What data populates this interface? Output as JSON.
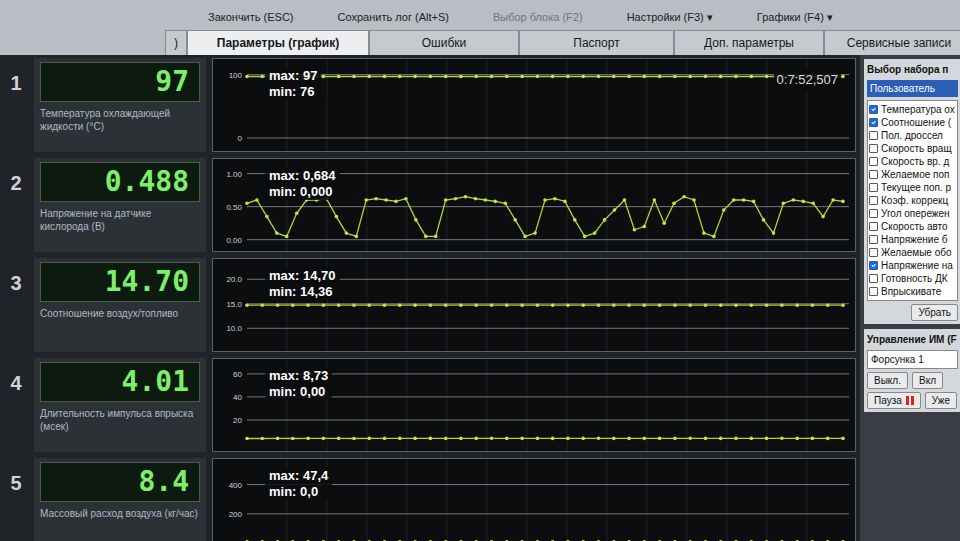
{
  "menu": [
    {
      "label": "Закончить (ESC)",
      "disabled": false
    },
    {
      "label": "Сохранить лог (Alt+S)",
      "disabled": false
    },
    {
      "label": "Выбор блока (F2)",
      "disabled": true
    },
    {
      "label": "Настройки (F3) ▾",
      "disabled": false
    },
    {
      "label": "Графики (F4) ▾",
      "disabled": false
    }
  ],
  "tabs": [
    {
      "label": ")",
      "selected": false
    },
    {
      "label": "Параметры (график)",
      "selected": true
    },
    {
      "label": "Ошибки",
      "selected": false
    },
    {
      "label": "Паспорт",
      "selected": false
    },
    {
      "label": "Доп. параметры",
      "selected": false
    },
    {
      "label": "Сервисные записи",
      "selected": false
    }
  ],
  "params": [
    {
      "number": "1",
      "value": "97",
      "label": "Температура охлаждающей жидкости (°C)",
      "chart": {
        "max": "max: 97",
        "min": "min: 76",
        "time": "0:7:52,507",
        "axis_min": -8,
        "axis_max": 112,
        "ticks": [
          {
            "label": "100",
            "value": 100
          },
          {
            "label": "0",
            "value": 0
          }
        ],
        "values": [
          97,
          97,
          97,
          97,
          97,
          97,
          97,
          97,
          97,
          97,
          97,
          97,
          97,
          97,
          97,
          97,
          97,
          97,
          97,
          97,
          97,
          97,
          97,
          97,
          97,
          97,
          97,
          97,
          97,
          97,
          97,
          97,
          97,
          97,
          97,
          97,
          97,
          97,
          97,
          97
        ]
      }
    },
    {
      "number": "2",
      "value": "0.488",
      "label": "Напряжение на датчике кислорода (В)",
      "chart": {
        "max": "max: 0,684",
        "min": "min: 0,000",
        "axis_min": -0.05,
        "axis_max": 1.1,
        "ticks": [
          {
            "label": "1.00",
            "value": 1.0
          },
          {
            "label": "0.50",
            "value": 0.5
          },
          {
            "label": "0.00",
            "value": 0.0
          }
        ],
        "values": [
          0.55,
          0.6,
          0.35,
          0.1,
          0.05,
          0.4,
          0.6,
          0.6,
          0.62,
          0.35,
          0.1,
          0.05,
          0.6,
          0.62,
          0.6,
          0.58,
          0.62,
          0.3,
          0.05,
          0.05,
          0.6,
          0.62,
          0.65,
          0.62,
          0.6,
          0.58,
          0.55,
          0.3,
          0.05,
          0.1,
          0.6,
          0.62,
          0.58,
          0.3,
          0.05,
          0.1,
          0.3,
          0.45,
          0.6,
          0.15,
          0.2,
          0.6,
          0.25,
          0.55,
          0.65,
          0.6,
          0.1,
          0.05,
          0.45,
          0.6,
          0.6,
          0.58,
          0.3,
          0.1,
          0.55,
          0.6,
          0.58,
          0.55,
          0.35,
          0.6,
          0.58
        ]
      }
    },
    {
      "number": "3",
      "value": "14.70",
      "label": "Соотношение воздух/топливо",
      "chart": {
        "max": "max: 14,70",
        "min": "min: 14,36",
        "axis_min": 7,
        "axis_max": 22.5,
        "ticks": [
          {
            "label": "20.0",
            "value": 20
          },
          {
            "label": "15.0",
            "value": 15
          },
          {
            "label": "10.0",
            "value": 10
          }
        ],
        "values": [
          14.7,
          14.7,
          14.7,
          14.7,
          14.7,
          14.7,
          14.7,
          14.7,
          14.7,
          14.7,
          14.7,
          14.7,
          14.7,
          14.7,
          14.7,
          14.7,
          14.7,
          14.7,
          14.7,
          14.7,
          14.7,
          14.7,
          14.7,
          14.7,
          14.7,
          14.7,
          14.7,
          14.7,
          14.7,
          14.7,
          14.7,
          14.7,
          14.7,
          14.7,
          14.7,
          14.7,
          14.7,
          14.7,
          14.7,
          14.7
        ]
      }
    },
    {
      "number": "4",
      "value": "4.01",
      "label": "Длительность импульса впрыска (мсек)",
      "chart": {
        "max": "max: 8,73",
        "min": "min: 0,00",
        "axis_min": 0,
        "axis_max": 66,
        "ticks": [
          {
            "label": "60",
            "value": 60
          },
          {
            "label": "40",
            "value": 40
          },
          {
            "label": "20",
            "value": 20
          }
        ],
        "values": [
          3.9,
          3.9,
          4.0,
          3.9,
          4.0,
          4.0,
          4.0,
          3.9,
          4.0,
          4.0,
          4.0,
          4.0,
          4.0,
          4.0,
          4.0,
          4.0,
          4.1,
          4.0,
          4.0,
          4.0,
          4.0,
          4.0,
          4.0,
          4.1,
          4.0,
          4.0,
          4.0,
          4.0,
          4.0,
          4.1,
          4.0,
          4.0,
          4.0,
          4.0,
          4.0,
          4.1,
          4.0,
          4.0,
          4.0,
          4.01
        ]
      }
    },
    {
      "number": "5",
      "value": "8.4",
      "label": "Массовый расход воздуха (кг/час)",
      "chart": {
        "max": "max: 47,4",
        "min": "min: 0,0",
        "axis_min": 0,
        "axis_max": 520,
        "ticks": [
          {
            "label": "400",
            "value": 400
          },
          {
            "label": "200",
            "value": 200
          }
        ],
        "values": [
          8.4,
          8.4,
          8.4,
          8.4,
          8.4,
          8.4,
          8.4,
          8.4,
          8.4,
          8.4,
          8.4,
          8.4,
          8.4,
          8.4,
          8.4,
          8.4,
          8.4,
          8.4,
          8.4,
          8.4,
          8.4,
          8.4,
          8.4,
          8.4,
          8.4,
          8.4,
          8.4,
          8.4,
          8.4,
          8.4,
          8.4,
          8.4,
          8.4,
          8.4,
          8.4,
          8.4,
          8.4,
          8.4,
          8.4,
          8.4
        ]
      }
    }
  ],
  "panel": {
    "title": "Выбор набора п",
    "preset": {
      "label": "Пользователь",
      "selected": true
    },
    "items": [
      {
        "label": "Температура ох",
        "checked": true
      },
      {
        "label": "Соотношение (",
        "checked": true
      },
      {
        "label": "Пол. дроссел",
        "checked": false
      },
      {
        "label": "Скорость вращ",
        "checked": false
      },
      {
        "label": "Скорость вр. д",
        "checked": false
      },
      {
        "label": "Желаемое поп",
        "checked": false
      },
      {
        "label": "Текущее поп. р",
        "checked": false
      },
      {
        "label": "Коэф. коррекц",
        "checked": false
      },
      {
        "label": "Угол опережен",
        "checked": false
      },
      {
        "label": "Скорость авто",
        "checked": false
      },
      {
        "label": "Напряжение б",
        "checked": false
      },
      {
        "label": "Желаемые обо",
        "checked": false
      },
      {
        "label": "Напряжение на",
        "checked": true
      },
      {
        "label": "Готовность ДК",
        "checked": false
      },
      {
        "label": "Впрыскивате",
        "checked": false
      }
    ],
    "remove_button": "Убрать"
  },
  "control": {
    "title": "Управление ИМ (F",
    "device": "Форсунка 1",
    "buttons": [
      "Выкл.",
      "Вкл"
    ],
    "pause": "Пауза",
    "more": "Уже"
  }
}
